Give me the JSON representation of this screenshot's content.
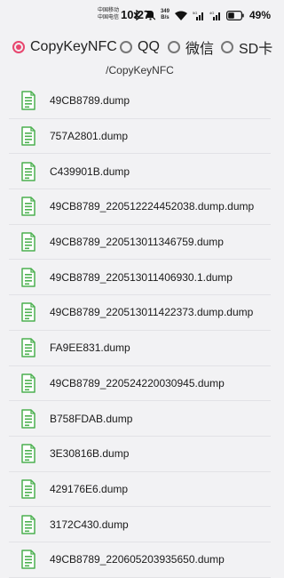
{
  "status_bar": {
    "carrier_1": "中国移动",
    "carrier_2": "中国电信",
    "time": "10:27",
    "net_speed_value": "349",
    "net_speed_unit": "B/s",
    "signal_1_label": "5G",
    "signal_2_label": "4G",
    "battery_percent": "49%"
  },
  "source_options": [
    {
      "label": "CopyKeyNFC",
      "selected": true
    },
    {
      "label": "QQ",
      "selected": false
    },
    {
      "label": "微信",
      "selected": false
    },
    {
      "label": "SD卡",
      "selected": false
    }
  ],
  "current_path": "/CopyKeyNFC",
  "files": [
    {
      "name": "49CB8789.dump"
    },
    {
      "name": "757A2801.dump"
    },
    {
      "name": "C439901B.dump"
    },
    {
      "name": "49CB8789_220512224452038.dump.dump"
    },
    {
      "name": "49CB8789_220513011346759.dump"
    },
    {
      "name": "49CB8789_220513011406930.1.dump"
    },
    {
      "name": "49CB8789_220513011422373.dump.dump"
    },
    {
      "name": "FA9EE831.dump"
    },
    {
      "name": "49CB8789_220524220030945.dump"
    },
    {
      "name": "B758FDAB.dump"
    },
    {
      "name": "3E30816B.dump"
    },
    {
      "name": "429176E6.dump"
    },
    {
      "name": "3172C430.dump"
    },
    {
      "name": "49CB8789_220605203935650.dump"
    }
  ],
  "colors": {
    "accent": "#e8476f",
    "file_icon": "#4cb050",
    "background": "#f2f2f4"
  },
  "icons": {
    "file": "document-icon"
  }
}
